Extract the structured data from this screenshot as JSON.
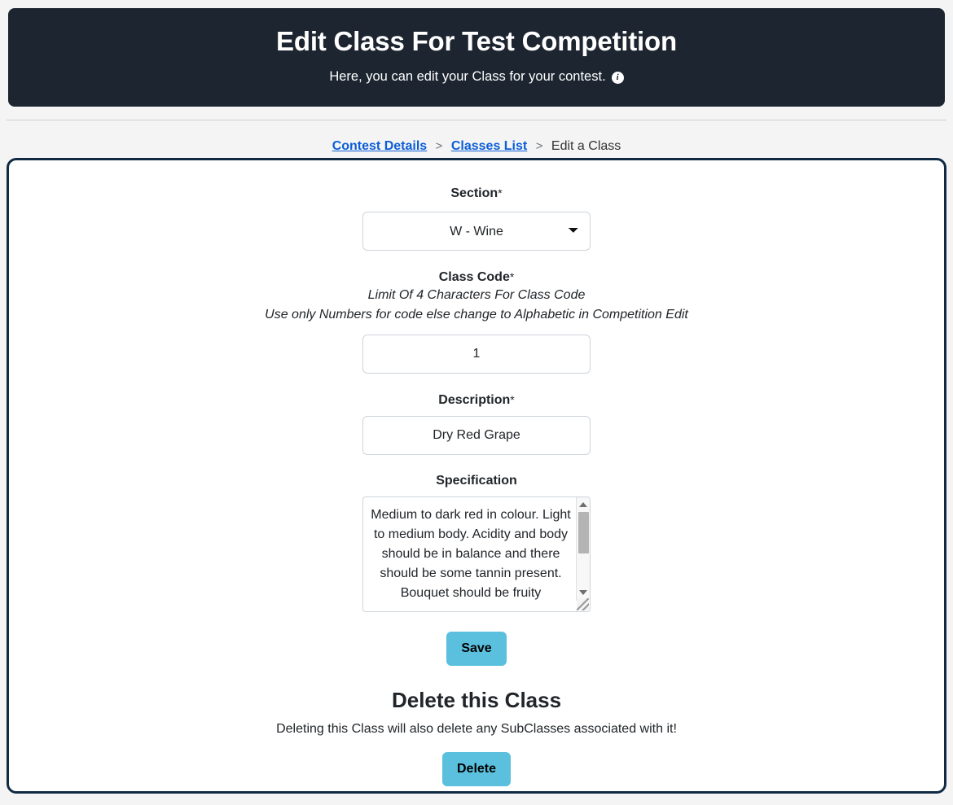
{
  "banner": {
    "title": "Edit Class For Test Competition",
    "subtitle": "Here, you can edit your Class for your contest.",
    "info_icon": "info-icon",
    "background_color": "#1d2630"
  },
  "breadcrumb": {
    "contest_details": "Contest Details",
    "classes_list": "Classes List",
    "current": "Edit a Class",
    "separator": ">",
    "link_color": "#0b5ed7"
  },
  "form": {
    "section": {
      "label": "Section",
      "required_mark": "*",
      "selected": "W - Wine",
      "options": [
        "W - Wine"
      ],
      "dropdown_icon": "chevron-down-icon"
    },
    "class_code": {
      "label": "Class Code",
      "required_mark": "*",
      "hint_1": "Limit Of 4 Characters For Class Code",
      "hint_2": "Use only Numbers for code else change to Alphabetic in Competition Edit",
      "value": "1",
      "placeholder": ""
    },
    "description": {
      "label": "Description",
      "required_mark": "*",
      "value": "Dry Red Grape",
      "placeholder": ""
    },
    "specification": {
      "label": "Specification",
      "required_mark": "",
      "value": "Medium to dark red in colour. Light to medium body. Acidity and body should be in balance and there should be some tannin present. Bouquet should be fruity",
      "placeholder": "",
      "scrollbar": {
        "up_arrow_icon": "scroll-up-arrow-icon",
        "down_arrow_icon": "scroll-down-arrow-icon",
        "resize_icon": "resize-grip-icon"
      }
    },
    "save_label": "Save"
  },
  "delete": {
    "heading": "Delete this Class",
    "note": "Deleting this Class will also delete any SubClasses associated with it!",
    "button_label": "Delete",
    "button_color": "#5bc0de"
  }
}
